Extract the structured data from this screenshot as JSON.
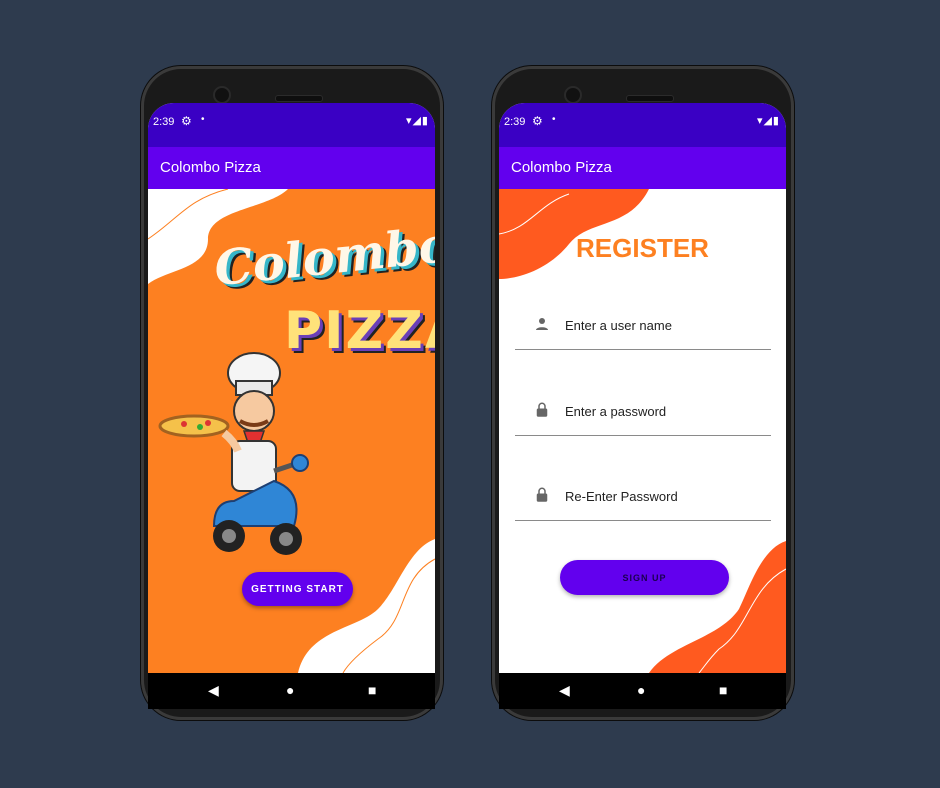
{
  "left_phone": {
    "status": {
      "time": "2:39"
    },
    "app_title": "Colombo Pizza",
    "logo": {
      "word1": "Colombo",
      "word2": "PIZZA"
    },
    "start_button": "GETTING START"
  },
  "right_phone": {
    "status": {
      "time": "2:39"
    },
    "app_title": "Colombo Pizza",
    "heading": "REGISTER",
    "fields": [
      {
        "placeholder": "Enter a user name",
        "icon": "person-icon"
      },
      {
        "placeholder": "Enter a password",
        "icon": "lock-icon"
      },
      {
        "placeholder": "Re-Enter Password",
        "icon": "lock-icon"
      }
    ],
    "signup_button": "SIGN UP"
  },
  "colors": {
    "status_bar": "#3a00c4",
    "app_bar": "#6200ee",
    "orange": "#fd8021",
    "accent_red_orange": "#ff5a1f",
    "background": "#2e3b4e"
  }
}
